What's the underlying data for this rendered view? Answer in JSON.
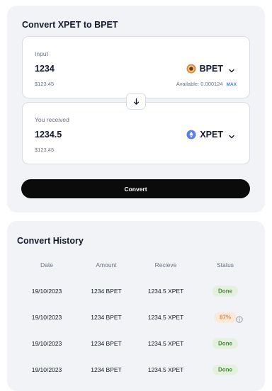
{
  "convert": {
    "title": "Convert XPET to BPET",
    "input": {
      "label": "Input",
      "amount": "1234",
      "usd": "$123.45",
      "token": "BPET",
      "token_icon": "bpet-coin-icon",
      "available": "Available: 0.000124",
      "max_label": "MAX"
    },
    "output": {
      "label": "You received",
      "amount": "1234.5",
      "usd": "$123.45",
      "token": "XPET",
      "token_icon": "xpet-coin-icon"
    },
    "swap_icon": "arrow-down-icon",
    "button_label": "Convert",
    "colors": {
      "accent_link": "#4b7be5",
      "button_bg": "#0b0b0c",
      "bpet_coin": "#e0893c",
      "xpet_coin": "#5a7fe8"
    }
  },
  "history": {
    "title": "Convert History",
    "columns": [
      "Date",
      "Amount",
      "Recieve",
      "Status"
    ],
    "rows": [
      {
        "date": "19/10/2023",
        "amount": "1234 BPET",
        "receive": "1234.5 XPET",
        "status": "Done",
        "state": "done"
      },
      {
        "date": "19/10/2023",
        "amount": "1234 BPET",
        "receive": "1234.5 XPET",
        "status": "87%",
        "state": "pending"
      },
      {
        "date": "19/10/2023",
        "amount": "1234 BPET",
        "receive": "1234.5 XPET",
        "status": "Done",
        "state": "done"
      },
      {
        "date": "19/10/2023",
        "amount": "1234 BPET",
        "receive": "1234.5 XPET",
        "status": "Done",
        "state": "done"
      }
    ],
    "status_colors": {
      "done_bg": "#e5f1df",
      "done_text": "#4d8a3c",
      "pending_bg": "#fde9d9",
      "pending_text": "#e4884a"
    }
  }
}
